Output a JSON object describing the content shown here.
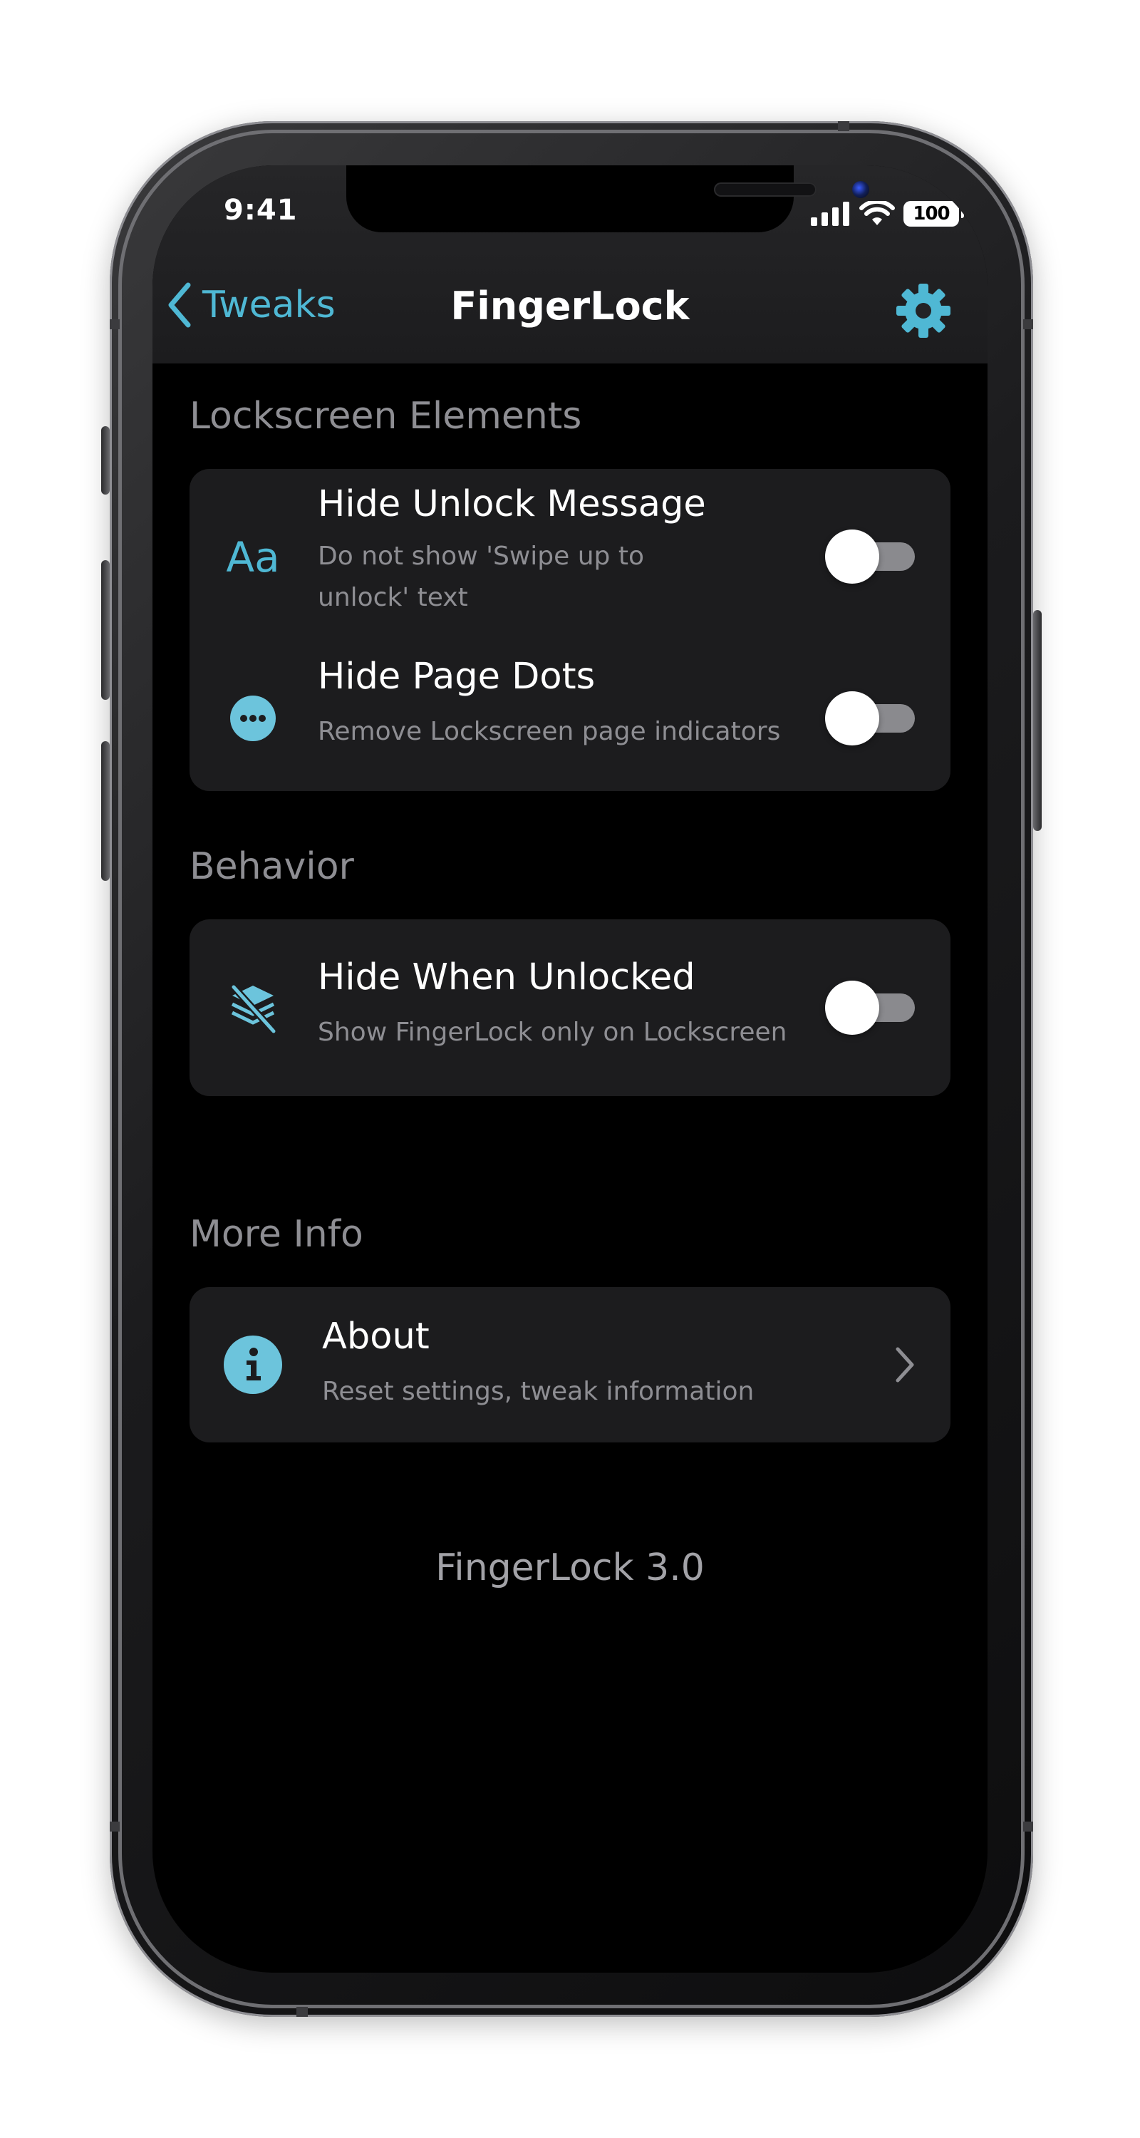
{
  "status_bar": {
    "time": "9:41",
    "battery": "100"
  },
  "nav": {
    "back_label": "Tweaks",
    "title": "FingerLock",
    "accent_color": "#4fb8d4"
  },
  "sections": [
    {
      "header": "Lockscreen Elements",
      "rows": [
        {
          "icon": "text-format-icon",
          "icon_text": "Aa",
          "title": "Hide Unlock Message",
          "subtitle_line1": "Do not show 'Swipe up to",
          "subtitle_line2": "unlock' text",
          "toggle_on": false
        },
        {
          "icon": "ellipsis-circle-icon",
          "title": "Hide Page Dots",
          "subtitle": "Remove Lockscreen page indicators",
          "toggle_on": false
        }
      ]
    },
    {
      "header": "Behavior",
      "rows": [
        {
          "icon": "layers-slash-icon",
          "title": "Hide When Unlocked",
          "subtitle": "Show FingerLock only on Lockscreen",
          "toggle_on": false
        }
      ]
    },
    {
      "header": "More Info",
      "rows": [
        {
          "icon": "info-circle-icon",
          "title": "About",
          "subtitle": "Reset settings, tweak information"
        }
      ]
    }
  ],
  "footer": {
    "version": "FingerLock 3.0"
  }
}
